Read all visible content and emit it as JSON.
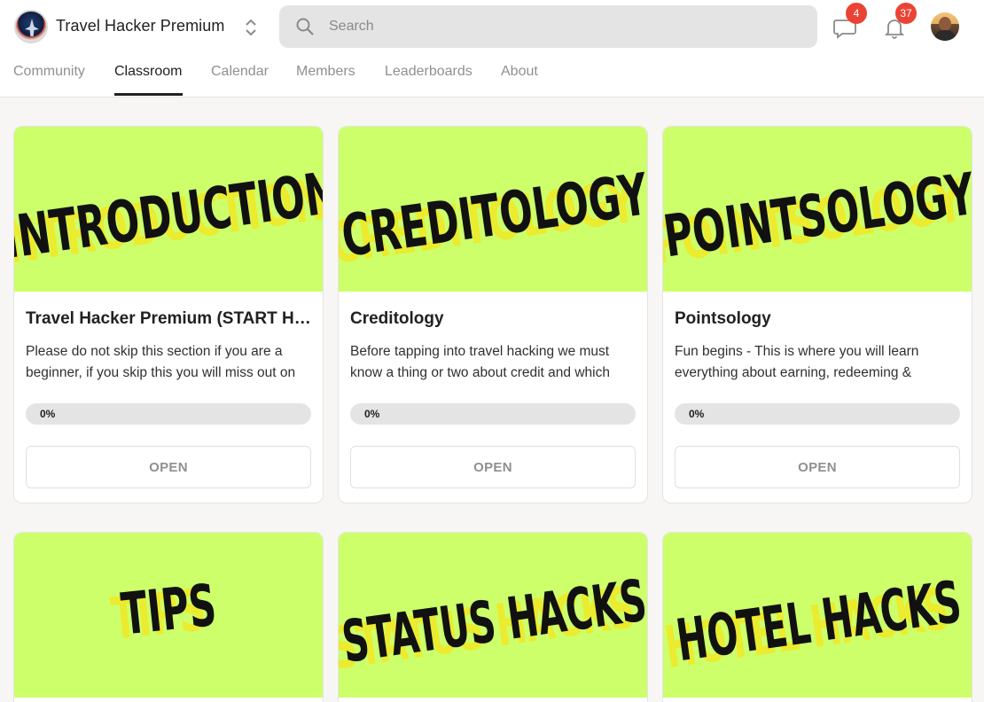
{
  "header": {
    "group_name": "Travel Hacker Premium",
    "search_placeholder": "Search",
    "chat_badge": "4",
    "notifications_badge": "37"
  },
  "tabs": [
    {
      "label": "Community",
      "active": false
    },
    {
      "label": "Classroom",
      "active": true
    },
    {
      "label": "Calendar",
      "active": false
    },
    {
      "label": "Members",
      "active": false
    },
    {
      "label": "Leaderboards",
      "active": false
    },
    {
      "label": "About",
      "active": false
    }
  ],
  "colors": {
    "cover_bg": "#cdff6b",
    "cover_shadow": "#f5e51b",
    "badge": "#ea4335"
  },
  "courses": [
    {
      "cover_text": "INTRODUCTION",
      "title": "Travel Hacker Premium (START HERE)",
      "description": "Please do not skip this section if you are a beginner, if you skip this you will miss out on",
      "progress_label": "0%",
      "progress": 0,
      "button": "OPEN"
    },
    {
      "cover_text": "CREDITOLOGY",
      "title": "Creditology",
      "description": "Before tapping into travel hacking we must know a thing or two about credit and which",
      "progress_label": "0%",
      "progress": 0,
      "button": "OPEN"
    },
    {
      "cover_text": "POINTSOLOGY",
      "title": "Pointsology",
      "description": "Fun begins - This is where you will learn everything about earning, redeeming &",
      "progress_label": "0%",
      "progress": 0,
      "button": "OPEN"
    },
    {
      "cover_text": "TIPS"
    },
    {
      "cover_text": "STATUS HACKS"
    },
    {
      "cover_text": "HOTEL HACKS"
    }
  ]
}
